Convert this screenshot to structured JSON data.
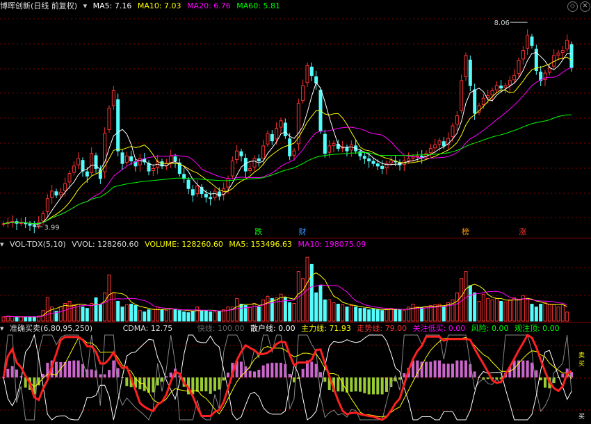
{
  "header": {
    "stock": "博晖创新(日线 前复权)",
    "ma5": "MA5: 7.16",
    "ma10": "MA10: 7.03",
    "ma20": "MA20: 6.76",
    "ma60": "MA60: 5.81",
    "high_label": "8.06",
    "low_label": "3.99",
    "colors": {
      "ma5": "#ffffff",
      "ma10": "#ffff00",
      "ma20": "#ff00ff",
      "ma60": "#00ff00"
    }
  },
  "markers": [
    {
      "text": "跌",
      "index": 58,
      "color": "#00ff00"
    },
    {
      "text": "财",
      "index": 68,
      "color": "#3399ff"
    },
    {
      "text": "榜",
      "index": 105,
      "color": "#ff9900"
    },
    {
      "text": "涨",
      "index": 118,
      "color": "#ff3333"
    }
  ],
  "volume_header": {
    "name": "VOL-TDX(5,10)",
    "vvol": "VVOL: 128260.60",
    "volume": "VOLUME: 128260.60",
    "ma5": "MA5: 153496.63",
    "ma10": "MA10: 198075.09"
  },
  "indicator_header": {
    "name": "准确买卖(6,80,95,250)",
    "cdma": "CDMA: 12.75",
    "fast": "快线: 100.00",
    "retail": "散户线: 0.00",
    "main": "主力线: 71.93",
    "trend": "走势线: 79.00",
    "watch_low": "关注低买: 0.00",
    "risk": "风险: 0.00",
    "watch_top": "观注顶: 0.00"
  },
  "right_labels": {
    "buy": "卖",
    "sell": "买",
    "bottom": "买"
  },
  "chart_data": [
    {
      "type": "candlestick",
      "series_name": "price",
      "ylim": [
        3.8,
        8.2
      ],
      "closes": [
        4.05,
        4.08,
        4.1,
        4.06,
        4.07,
        4.05,
        4.02,
        4.0,
        4.08,
        4.25,
        4.55,
        4.7,
        4.62,
        4.68,
        4.85,
        5.05,
        5.2,
        5.35,
        5.1,
        5.0,
        5.45,
        5.15,
        4.95,
        5.85,
        6.35,
        6.7,
        5.5,
        5.25,
        5.4,
        5.3,
        5.2,
        5.35,
        5.28,
        5.1,
        5.15,
        5.3,
        5.2,
        5.25,
        5.4,
        5.3,
        5.05,
        4.95,
        4.75,
        4.62,
        4.8,
        4.65,
        4.58,
        4.55,
        4.7,
        4.6,
        4.75,
        4.95,
        5.3,
        5.5,
        5.4,
        5.1,
        5.15,
        5.35,
        5.3,
        5.6,
        5.85,
        5.7,
        5.95,
        6.1,
        5.8,
        5.4,
        5.5,
        6.45,
        6.8,
        7.2,
        7.0,
        6.85,
        5.9,
        5.45,
        5.6,
        5.65,
        5.55,
        5.58,
        5.5,
        5.62,
        5.5,
        5.4,
        5.35,
        5.3,
        5.25,
        5.2,
        5.15,
        5.25,
        5.3,
        5.28,
        5.22,
        5.3,
        5.35,
        5.38,
        5.4,
        5.38,
        5.45,
        5.55,
        5.62,
        5.7,
        5.6,
        5.75,
        6.0,
        6.2,
        6.9,
        7.4,
        6.8,
        6.25,
        6.4,
        6.55,
        6.6,
        6.7,
        6.8,
        6.75,
        6.8,
        6.9,
        7.0,
        7.3,
        7.5,
        7.8,
        7.6,
        7.1,
        6.9,
        7.05,
        7.15,
        7.4,
        7.45,
        7.5,
        7.7,
        7.16
      ],
      "ma_series": [
        "MA5",
        "MA10",
        "MA20",
        "MA60"
      ],
      "markers": {
        "high": 8.06,
        "low": 3.99
      }
    },
    {
      "type": "bar",
      "series_name": "volume",
      "ylim": [
        0,
        1000000
      ],
      "values": [
        60000,
        70000,
        65000,
        55000,
        60000,
        58000,
        60000,
        62000,
        70000,
        150000,
        330000,
        200000,
        140000,
        200000,
        250000,
        280000,
        230000,
        240000,
        200000,
        180000,
        250000,
        330000,
        240000,
        400000,
        650000,
        400000,
        280000,
        200000,
        230000,
        240000,
        220000,
        150000,
        130000,
        160000,
        170000,
        200000,
        160000,
        150000,
        180000,
        170000,
        150000,
        130000,
        120000,
        140000,
        200000,
        150000,
        150000,
        130000,
        130000,
        140000,
        160000,
        200000,
        200000,
        320000,
        240000,
        220000,
        200000,
        250000,
        200000,
        300000,
        350000,
        320000,
        330000,
        380000,
        330000,
        260000,
        250000,
        700000,
        600000,
        900000,
        800000,
        400000,
        500000,
        300000,
        300000,
        260000,
        240000,
        230000,
        200000,
        220000,
        200000,
        180000,
        180000,
        160000,
        170000,
        160000,
        150000,
        170000,
        180000,
        170000,
        160000,
        150000,
        200000,
        240000,
        200000,
        190000,
        200000,
        220000,
        230000,
        240000,
        200000,
        260000,
        300000,
        400000,
        600000,
        700000,
        500000,
        400000,
        280000,
        380000,
        320000,
        300000,
        320000,
        280000,
        270000,
        300000,
        330000,
        300000,
        360000,
        320000,
        240000,
        200000,
        240000,
        260000,
        240000,
        230000,
        200000,
        230000,
        128260
      ]
    },
    {
      "type": "line",
      "series_name": "indicator",
      "ylim": [
        0,
        100
      ]
    }
  ]
}
